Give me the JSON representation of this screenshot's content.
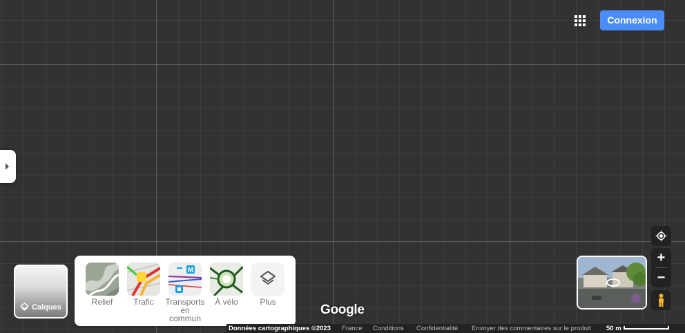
{
  "header": {
    "signin_label": "Connexion",
    "apps_icon": "apps-grid-icon"
  },
  "layers": {
    "button_label": "Calques",
    "items": [
      {
        "label": "Relief"
      },
      {
        "label": "Trafic"
      },
      {
        "label": "Transports\nen\ncommun"
      },
      {
        "label": "À vélo"
      },
      {
        "label": "Plus"
      }
    ]
  },
  "logo": "Google",
  "footer": {
    "map_data": "Données cartographiques ©2023",
    "country": "France",
    "terms": "Conditions",
    "privacy": "Confidentialité",
    "feedback": "Envoyer des commentaires sur le produit",
    "scale": "50 m"
  },
  "colors": {
    "accent": "#4b8df8",
    "map_bg": "#323232"
  }
}
